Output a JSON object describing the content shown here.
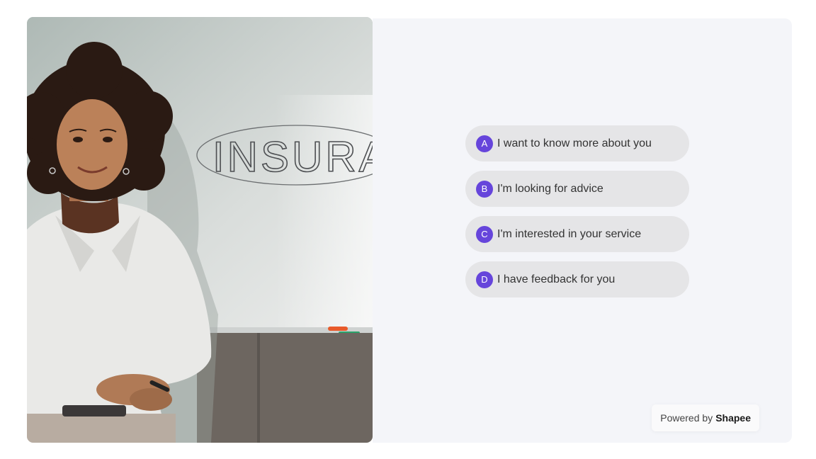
{
  "options": [
    {
      "key": "A",
      "label": "I want to know more about you"
    },
    {
      "key": "B",
      "label": "I'm looking for advice"
    },
    {
      "key": "C",
      "label": "I'm interested in your service"
    },
    {
      "key": "D",
      "label": "I have feedback for you"
    }
  ],
  "photo": {
    "whiteboard_text": "INSURA"
  },
  "footer": {
    "powered_prefix": "Powered by",
    "brand": "Shapee"
  },
  "colors": {
    "badge": "#6645db",
    "option_bg": "#e5e5e7",
    "panel_bg": "#f4f5f9"
  }
}
